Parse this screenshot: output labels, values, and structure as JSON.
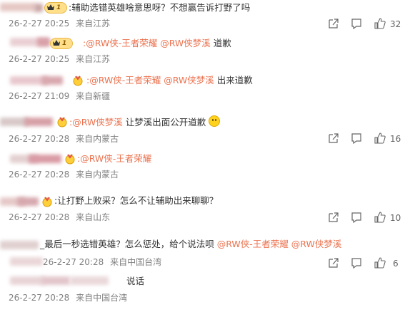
{
  "comments": [
    {
      "level": "reply",
      "text": ":辅助选错英雄啥意思呀？不想赢告诉打野了吗",
      "time": "26-2-27 20:25",
      "location": "来自江苏",
      "likes": "32"
    },
    {
      "level": "sub",
      "mentions": [
        ":@RW侠-王者荣耀",
        "@RW侠梦溪"
      ],
      "text": " 道歉",
      "time": "26-2-27 20:25",
      "location": "来自江苏"
    },
    {
      "level": "sub",
      "mentions": [
        ":@RW侠-王者荣耀",
        "@RW侠梦溪"
      ],
      "text": " 出来道歉",
      "time": "26-2-27 21:09",
      "location": "来自新疆"
    },
    {
      "level": "reply",
      "mentions": [
        ":@RW侠梦溪"
      ],
      "text": " 让梦溪出面公开道歉",
      "time": "26-2-27 20:28",
      "location": "来自内蒙古",
      "likes": "16"
    },
    {
      "level": "sub",
      "mentions": [
        ":@RW侠-王者荣耀"
      ],
      "text": "",
      "time": "26-2-27 20:28",
      "location": "来自内蒙古"
    },
    {
      "level": "reply",
      "text": ":让打野上败采？怎么不让辅助出来聊聊？",
      "time": "26-2-27 20:28",
      "location": "来自山东",
      "likes": "10"
    },
    {
      "level": "reply",
      "text": "_最后一秒选错英雄？怎么惩处，给个说法呗",
      "mentions": [
        "@RW侠-王者荣耀",
        "@RW侠梦溪"
      ],
      "time": "26-2-27 20:28",
      "location": "来自中国台湾",
      "likes": "6"
    },
    {
      "level": "sub",
      "text": "说话",
      "time": "26-2-27 20:28",
      "location": "来自中国台湾"
    }
  ],
  "badge_level": "1",
  "icons": [
    "share-icon",
    "comment-icon",
    "like-icon",
    "vip-crown-icon",
    "medal-icon",
    "smile-emoji-icon"
  ],
  "colors": {
    "mention": "#eb7350",
    "meta": "#808080",
    "text": "#333333",
    "badge": "#ffdf8a"
  }
}
